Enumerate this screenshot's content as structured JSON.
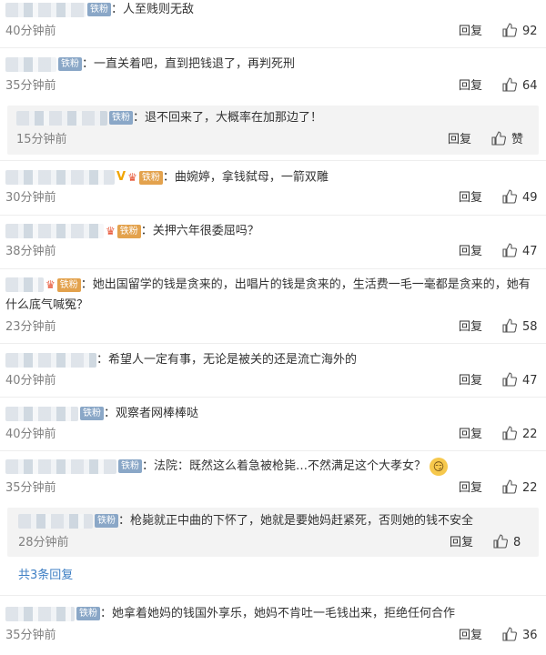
{
  "fan_badge": "铁粉",
  "reply_label": "回复",
  "comments": [
    {
      "text": "人至贱则无敌",
      "time": "40分钟前",
      "likes": "92"
    },
    {
      "text": "一直关着吧，直到把钱退了，再判死刑",
      "time": "35分钟前",
      "likes": "64"
    },
    {
      "text": "退不回来了，大概率在加那边了！",
      "time": "15分钟前",
      "likes": "赞"
    },
    {
      "text": "曲婉婷，拿钱弑母，一箭双雕",
      "time": "30分钟前",
      "likes": "49"
    },
    {
      "text": "关押六年很委屈吗？",
      "time": "38分钟前",
      "likes": "47"
    },
    {
      "text": "她出国留学的钱是贪来的，出唱片的钱是贪来的，生活费一毛一毫都是贪来的，她有什么底气喊冤？",
      "time": "23分钟前",
      "likes": "58"
    },
    {
      "text": "希望人一定有事，无论是被关的还是流亡海外的",
      "time": "40分钟前",
      "likes": "47"
    },
    {
      "text": "观察者网棒棒哒",
      "time": "40分钟前",
      "likes": "22"
    },
    {
      "text": "法院：既然这么着急被枪毙…不然满足这个大孝女？",
      "time": "35分钟前",
      "likes": "22"
    },
    {
      "text": "枪毙就正中曲的下怀了，她就是要她妈赶紧死，否则她的钱不安全",
      "time": "28分钟前",
      "likes": "8"
    },
    {
      "text": "她拿着她妈的钱国外享乐，她妈不肯吐一毛钱出来，拒绝任何合作",
      "time": "35分钟前",
      "likes": "36"
    }
  ],
  "more_replies": "共3条回复",
  "emoji_names": [
    "thumb-up-icon",
    "smirk-emoji-icon",
    "crown-icon",
    "verified-v-icon"
  ]
}
